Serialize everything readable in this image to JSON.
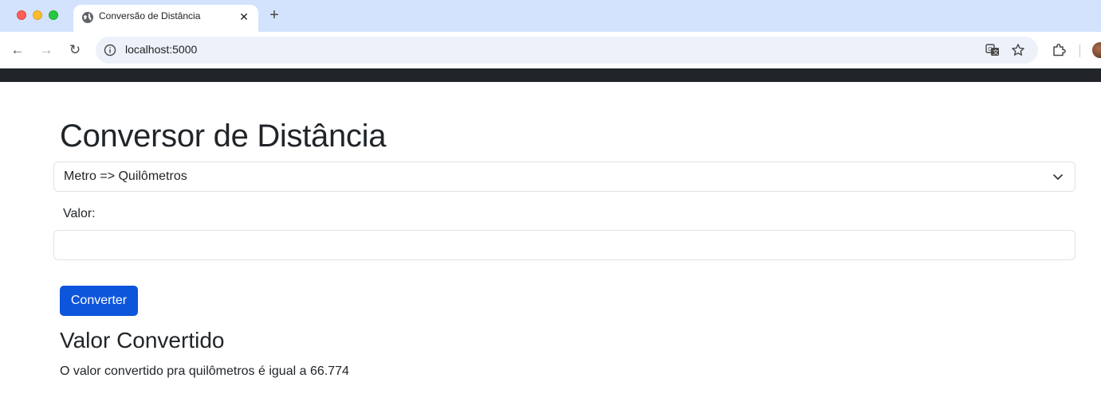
{
  "browser": {
    "tab_title": "Conversão de Distância",
    "tab_favicon": "globe-icon",
    "tab_close_glyph": "✕",
    "newtab_glyph": "+",
    "url": "localhost:5000",
    "nav": {
      "back_glyph": "←",
      "forward_glyph": "→",
      "reload_glyph": "↻"
    },
    "icons": [
      "info-icon",
      "translate-icon",
      "star-icon",
      "extensions-icon",
      "profile-avatar"
    ]
  },
  "page": {
    "title": "Conversor de Distância",
    "conversion_select": {
      "selected": "Metro => Quilômetros"
    },
    "value_label": "Valor:",
    "value_input": {
      "value": "",
      "placeholder": ""
    },
    "convert_button": "Converter",
    "result_heading": "Valor Convertido",
    "result_text": "O valor convertido pra quilômetros é igual a 66.774"
  },
  "colors": {
    "primary_button": "#0d55db",
    "navbar": "#212529",
    "tabbar": "#d3e3fd",
    "text": "#212529"
  }
}
